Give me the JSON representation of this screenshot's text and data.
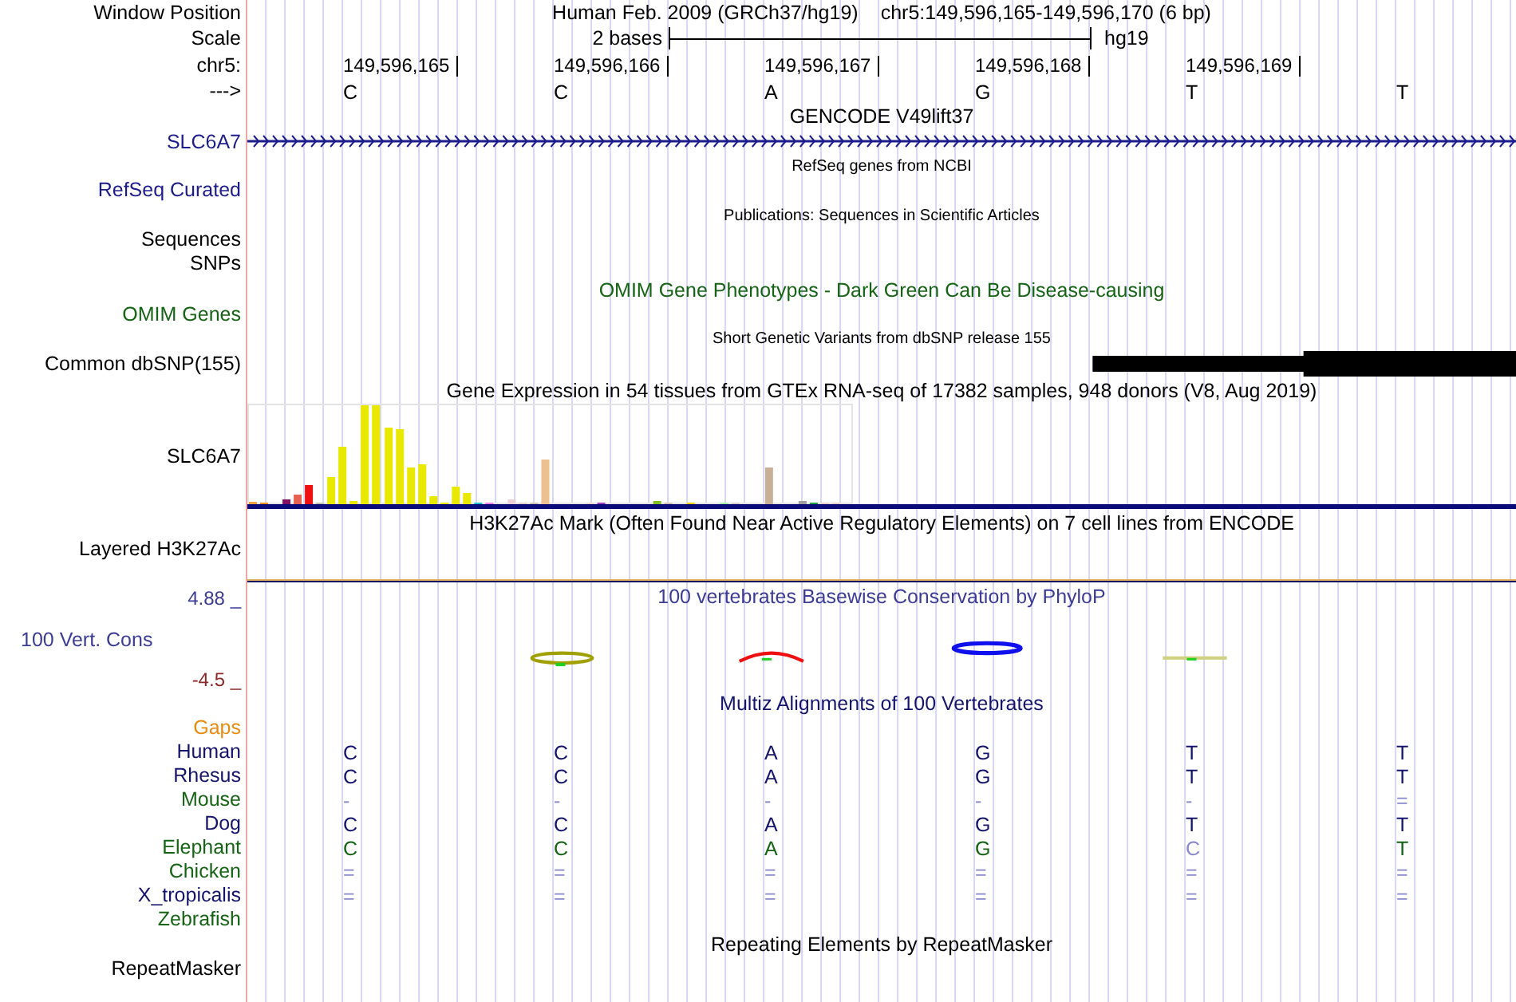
{
  "header": {
    "assembly": "Human Feb. 2009 (GRCh37/hg19)",
    "position": "chr5:149,596,165-149,596,170 (6 bp)",
    "labels": [
      "Window Position",
      "Scale",
      "chr5:",
      "--->"
    ],
    "scale_text": "2 bases",
    "scale_assembly": "hg19",
    "positions": [
      "149,596,165",
      "149,596,166",
      "149,596,167",
      "149,596,168",
      "149,596,169"
    ],
    "bases": [
      "C",
      "C",
      "A",
      "G",
      "T",
      "T"
    ]
  },
  "tracks": [
    {
      "kind": "gene",
      "compact": false,
      "title": {
        "text": "GENCODE V49lift37",
        "color": "#000000"
      },
      "labels": [
        {
          "text": "SLC6A7",
          "color": "#1c1c8c"
        }
      ]
    },
    {
      "kind": "annotation",
      "compact": true,
      "title": {
        "text": "RefSeq genes from NCBI",
        "color": "#000000"
      },
      "labels": [
        {
          "text": "RefSeq Curated",
          "color": "#1c1c8c"
        }
      ]
    },
    {
      "kind": "annotation",
      "compact": true,
      "title": {
        "text": "Publications: Sequences in Scientific Articles",
        "color": "#000000"
      },
      "labels": [
        {
          "text": "Sequences",
          "color": "#000000"
        },
        {
          "text": "SNPs",
          "color": "#000000"
        }
      ]
    },
    {
      "kind": "annotation",
      "compact": false,
      "title": {
        "text": "OMIM Gene Phenotypes - Dark Green Can Be Disease-causing",
        "color": "#146414"
      },
      "labels": [
        {
          "text": "OMIM Genes",
          "color": "#146414"
        }
      ]
    },
    {
      "kind": "snp",
      "compact": true,
      "title": {
        "text": "Short Genetic Variants from dbSNP release 155",
        "color": "#000000"
      },
      "labels": [
        {
          "text": "Common dbSNP(155)",
          "color": "#000000"
        }
      ]
    },
    {
      "kind": "expression",
      "compact": false,
      "title": {
        "text": "Gene Expression in 54 tissues from GTEx RNA-seq of 17382 samples, 948 donors (V8, Aug 2019)",
        "color": "#000000"
      },
      "labels": [
        {
          "text": "SLC6A7",
          "color": "#000000"
        }
      ]
    },
    {
      "kind": "signal",
      "compact": false,
      "title": {
        "text": "H3K27Ac Mark (Often Found Near Active Regulatory Elements) on 7 cell lines from ENCODE",
        "color": "#000000"
      },
      "labels": [
        {
          "text": "Layered H3K27Ac",
          "color": "#000000"
        }
      ]
    },
    {
      "kind": "conservation",
      "compact": false,
      "title": {
        "text": "100 vertebrates Basewise Conservation by PhyloP",
        "color": "#3c3c96"
      },
      "labels": [
        {
          "text": "100 Vert. Cons",
          "color": "#3c3c96"
        }
      ],
      "ticks": [
        {
          "text": "4.88 _",
          "color": "#3c3c96"
        },
        {
          "text": "-4.5 _",
          "color": "#8c2a2a"
        }
      ]
    },
    {
      "kind": "alignment",
      "compact": false,
      "title": {
        "text": "Multiz Alignments of 100 Vertebrates",
        "color": "#14146e"
      },
      "species": [
        {
          "name": "Gaps",
          "color": "#e88c10"
        },
        {
          "name": "Human",
          "color": "#14146e",
          "bases": [
            {
              "base": "C",
              "faded": false
            },
            {
              "base": "C",
              "faded": false
            },
            {
              "base": "A",
              "faded": false
            },
            {
              "base": "G",
              "faded": false
            },
            {
              "base": "T",
              "faded": false
            },
            {
              "base": "T",
              "faded": false
            }
          ]
        },
        {
          "name": "Rhesus",
          "color": "#14146e",
          "bases": [
            {
              "base": "C",
              "faded": false
            },
            {
              "base": "C",
              "faded": false
            },
            {
              "base": "A",
              "faded": false
            },
            {
              "base": "G",
              "faded": false
            },
            {
              "base": "T",
              "faded": false
            },
            {
              "base": "T",
              "faded": false
            }
          ]
        },
        {
          "name": "Mouse",
          "color": "#146414",
          "bases": [
            {
              "base": "-",
              "faded": true
            },
            {
              "base": "-",
              "faded": true
            },
            {
              "base": "-",
              "faded": true
            },
            {
              "base": "-",
              "faded": true
            },
            {
              "base": "-",
              "faded": true
            },
            {
              "base": "=",
              "faded": true
            }
          ]
        },
        {
          "name": "Dog",
          "color": "#14146e",
          "bases": [
            {
              "base": "C",
              "faded": false
            },
            {
              "base": "C",
              "faded": false
            },
            {
              "base": "A",
              "faded": false
            },
            {
              "base": "G",
              "faded": false
            },
            {
              "base": "T",
              "faded": false
            },
            {
              "base": "T",
              "faded": false
            }
          ]
        },
        {
          "name": "Elephant",
          "color": "#146414",
          "bases": [
            {
              "base": "C",
              "faded": false
            },
            {
              "base": "C",
              "faded": false
            },
            {
              "base": "A",
              "faded": false
            },
            {
              "base": "G",
              "faded": false
            },
            {
              "base": "C",
              "faded": true
            },
            {
              "base": "T",
              "faded": false
            }
          ]
        },
        {
          "name": "Chicken",
          "color": "#146414",
          "bases": [
            {
              "base": "=",
              "faded": true
            },
            {
              "base": "=",
              "faded": true
            },
            {
              "base": "=",
              "faded": true
            },
            {
              "base": "=",
              "faded": true
            },
            {
              "base": "=",
              "faded": true
            },
            {
              "base": "=",
              "faded": true
            }
          ]
        },
        {
          "name": "X_tropicalis",
          "color": "#14146e",
          "bases": [
            {
              "base": "=",
              "faded": true
            },
            {
              "base": "=",
              "faded": true
            },
            {
              "base": "=",
              "faded": true
            },
            {
              "base": "=",
              "faded": true
            },
            {
              "base": "=",
              "faded": true
            },
            {
              "base": "=",
              "faded": true
            }
          ]
        },
        {
          "name": "Zebrafish",
          "color": "#146414"
        }
      ]
    },
    {
      "kind": "annotation",
      "compact": false,
      "tall": true,
      "title": {
        "text": "Repeating Elements by RepeatMasker",
        "color": "#000000"
      },
      "labels": [
        {
          "text": "RepeatMasker",
          "color": "#000000"
        }
      ]
    }
  ]
}
